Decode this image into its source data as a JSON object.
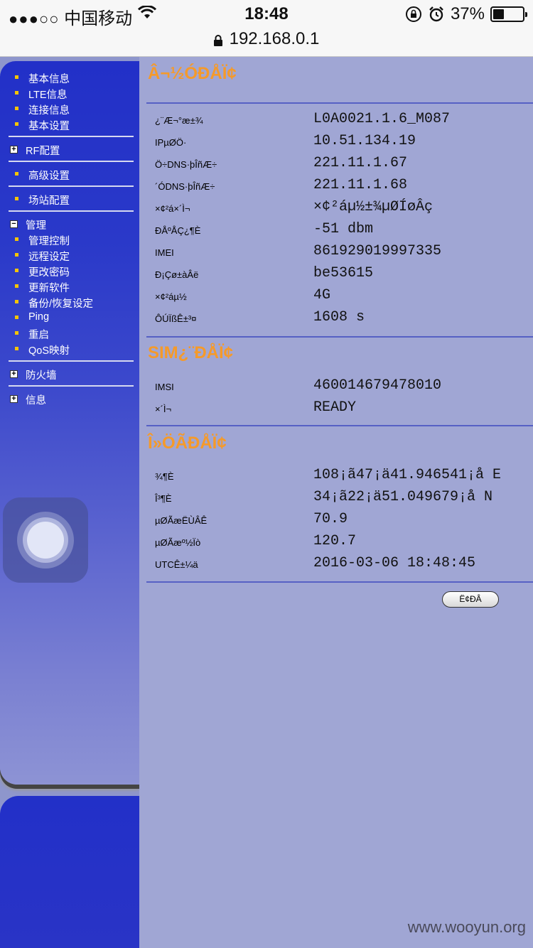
{
  "status_bar": {
    "signal": "●●●○○",
    "carrier": "中国移动",
    "time": "18:48",
    "battery_percent": "37%",
    "battery_level": 0.37
  },
  "url_bar": {
    "url": "192.168.0.1"
  },
  "sidebar": {
    "top_items": [
      "基本信息",
      "LTE信息",
      "连接信息",
      "基本设置"
    ],
    "rf_group": "RF配置",
    "advanced": "高级设置",
    "site": "场站配置",
    "manage_group": "管理",
    "manage_items": [
      "管理控制",
      "远程设定",
      "更改密码",
      "更新软件",
      "备份/恢复设定",
      "Ping",
      "重启",
      "QoS映射"
    ],
    "firewall_group": "防火墙",
    "info_group": "信息",
    "expand_symbol": "+",
    "collapse_symbol": "−"
  },
  "sections": {
    "status": {
      "title": "Â¬½ÓÐÅÏ¢",
      "rows": [
        {
          "label": "¿¨Æ¬°æ±¾",
          "value": "L0A0021.1.6_M087"
        },
        {
          "label": "IPµØÖ·",
          "value": "10.51.134.19"
        },
        {
          "label": "Ö÷DNS·þÎñÆ÷",
          "value": "221.11.1.67"
        },
        {
          "label": "´ÓDNS·þÎñÆ÷",
          "value": "221.11.1.68"
        },
        {
          "label": "×¢²á×´Ì¬",
          "value": "×¢²áµ½±¾µØÍøÂç"
        },
        {
          "label": "ÐÅºÅÇ¿¶È",
          "value": "-51 dbm"
        },
        {
          "label": "IMEI",
          "value": "861929019997335"
        },
        {
          "label": "Ð¡Çø±àÂë",
          "value": "be53615"
        },
        {
          "label": "×¢²áµ½",
          "value": "4G"
        },
        {
          "label": "ÔÚÏßÊ±³¤",
          "value": "1608 s"
        }
      ]
    },
    "sim": {
      "title": "SIM¿¨ÐÅÏ¢",
      "rows": [
        {
          "label": "IMSI",
          "value": "460014679478010"
        },
        {
          "label": "×´Ì¬",
          "value": "READY"
        }
      ]
    },
    "location": {
      "title": "Î»ÖÃÐÅÏ¢",
      "rows": [
        {
          "label": "¾¶È",
          "value": "108¡ã47¡ä41.946541¡å E"
        },
        {
          "label": "Î³¶È",
          "value": "34¡ã22¡ä51.049679¡å N"
        },
        {
          "label": "µØÃæËÙÂÊ",
          "value": "70.9"
        },
        {
          "label": "µØÃæº½Ïò",
          "value": "120.7"
        },
        {
          "label": "UTCÊ±¼ä",
          "value": "2016-03-06 18:48:45"
        }
      ]
    }
  },
  "refresh_button": "Ë¢ÐÂ",
  "watermark": "www.wooyun.org"
}
